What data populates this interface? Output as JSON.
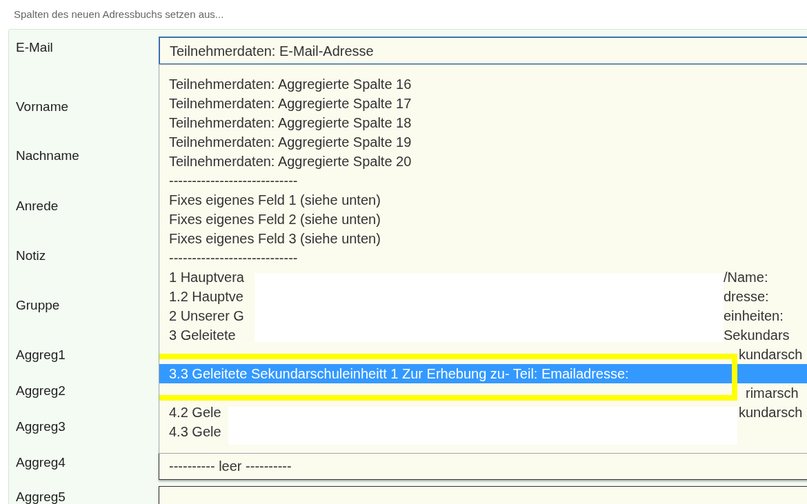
{
  "heading": "Spalten des neuen Adressbuchs setzen aus...",
  "fields": [
    {
      "label": "E-Mail",
      "value": "Teilnehmerdaten: E-Mail-Adresse",
      "expanded": true
    },
    {
      "label": "Vorname"
    },
    {
      "label": "Nachname"
    },
    {
      "label": "Anrede"
    },
    {
      "label": "Notiz"
    },
    {
      "label": "Gruppe"
    },
    {
      "label": "Aggreg1"
    },
    {
      "label": "Aggreg2"
    },
    {
      "label": "Aggreg3"
    },
    {
      "label": "Aggreg4",
      "value": "---------- leer ----------",
      "expanded": false
    },
    {
      "label": "Aggreg5",
      "expanded": false
    }
  ],
  "options": [
    {
      "text": "Teilnehmerdaten: Aggregierte Spalte 16",
      "selected": false
    },
    {
      "text": "Teilnehmerdaten: Aggregierte Spalte 17",
      "selected": false
    },
    {
      "text": "Teilnehmerdaten: Aggregierte Spalte 18",
      "selected": false
    },
    {
      "text": "Teilnehmerdaten: Aggregierte Spalte 19",
      "selected": false
    },
    {
      "text": "Teilnehmerdaten: Aggregierte Spalte 20",
      "selected": false
    },
    {
      "text": "----------------------------",
      "selected": false
    },
    {
      "text": "Fixes eigenes Feld 1 (siehe unten)",
      "selected": false
    },
    {
      "text": "Fixes eigenes Feld 2 (siehe unten)",
      "selected": false
    },
    {
      "text": "Fixes eigenes Feld 3 (siehe unten)",
      "selected": false
    },
    {
      "text": "----------------------------",
      "selected": false
    },
    {
      "text": "1 Hauptvera",
      "text_end": "/Name:",
      "selected": false
    },
    {
      "text": "1.2 Hauptve",
      "text_end": "dresse:",
      "selected": false
    },
    {
      "text": "2 Unserer G",
      "text_end": "einheiten:",
      "selected": false
    },
    {
      "text": "3 Geleitete",
      "text_end": "Sekundars",
      "selected": false
    },
    {
      "text_end": "kundarsch",
      "selected": false
    },
    {
      "text": "3.3 Geleitete Sekundarschuleinheitt 1 Zur Erhebung zu- Teil: Emailadresse:",
      "selected": true
    },
    {
      "text_end": "rimarsch",
      "selected": false
    },
    {
      "text": "4.2 Gele",
      "text_end": "kundarsch",
      "selected": false
    },
    {
      "text": "4.3 Gele",
      "selected": false
    }
  ]
}
